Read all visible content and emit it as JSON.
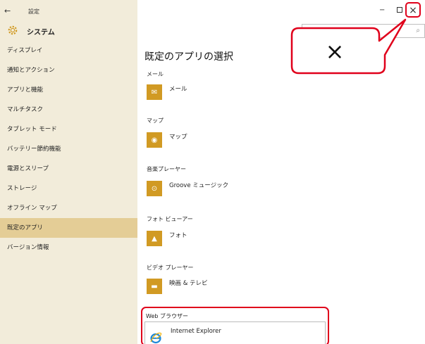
{
  "titlebar": {
    "title": "設定",
    "back_icon": "back-arrow-icon"
  },
  "header": {
    "app_heading": "システム",
    "icon": "gear-icon"
  },
  "sidebar": {
    "items": [
      {
        "label": "ディスプレイ"
      },
      {
        "label": "通知とアクション"
      },
      {
        "label": "アプリと機能"
      },
      {
        "label": "マルチタスク"
      },
      {
        "label": "タブレット モード"
      },
      {
        "label": "バッテリー節約機能"
      },
      {
        "label": "電源とスリープ"
      },
      {
        "label": "ストレージ"
      },
      {
        "label": "オフライン マップ"
      },
      {
        "label": "既定のアプリ"
      },
      {
        "label": "バージョン情報"
      }
    ],
    "selected_index": 9
  },
  "window_controls": {
    "minimize": "−",
    "close": "×"
  },
  "callout": {
    "label": "×"
  },
  "main": {
    "title": "既定のアプリの選択",
    "sections": [
      {
        "label": "メール",
        "app": "メール",
        "icon": "mail-icon"
      },
      {
        "label": "マップ",
        "app": "マップ",
        "icon": "map-icon"
      },
      {
        "label": "音楽プレーヤー",
        "app": "Groove ミュージック",
        "icon": "music-icon"
      },
      {
        "label": "フォト ビューアー",
        "app": "フォト",
        "icon": "photo-icon"
      },
      {
        "label": "ビデオ プレーヤー",
        "app": "映画 & テレビ",
        "icon": "video-icon"
      }
    ],
    "browser": {
      "label": "Web ブラウザー",
      "app": "Internet Explorer",
      "icon": "internet-explorer-icon"
    }
  },
  "colors": {
    "accent": "#d19a23",
    "sidebar_bg": "#f2ecda",
    "selected_bg": "#e4cd96",
    "highlight": "#e0001b"
  }
}
